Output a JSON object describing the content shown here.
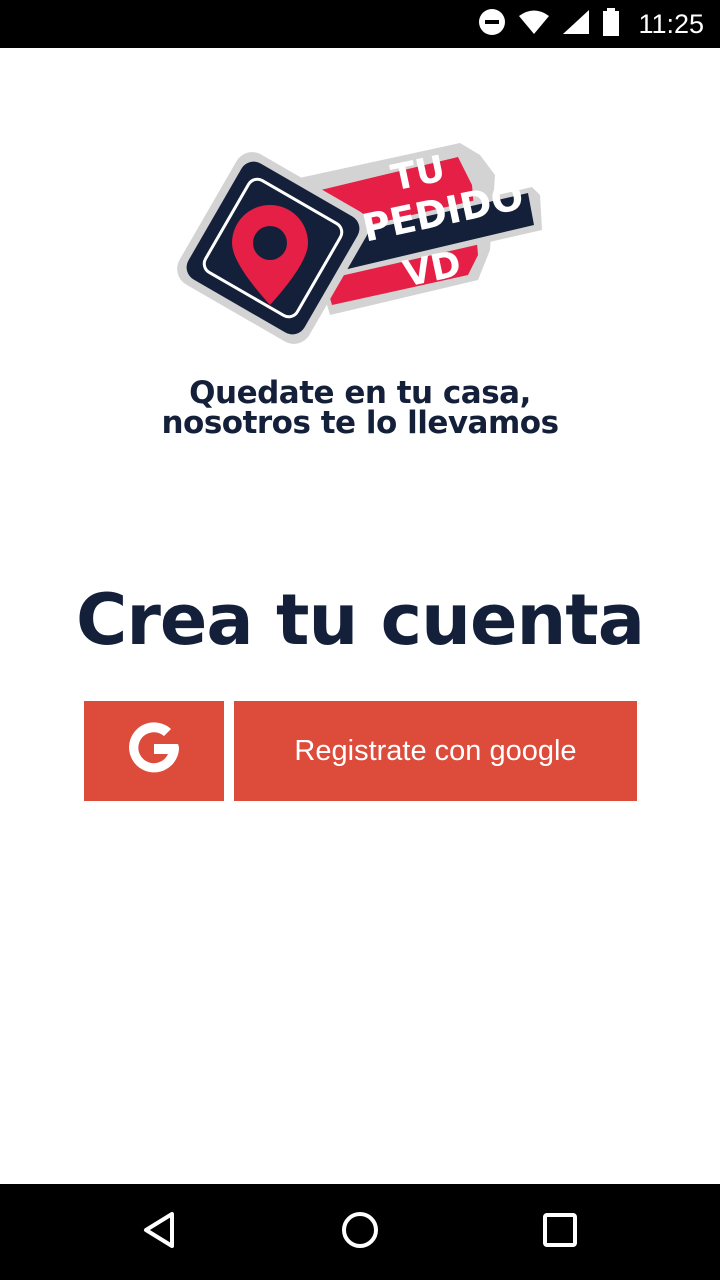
{
  "status_bar": {
    "time": "11:25",
    "icons": [
      "do-not-disturb-icon",
      "wifi-icon",
      "signal-icon",
      "battery-icon"
    ]
  },
  "logo": {
    "line1": "TU",
    "line2": "PEDIDO",
    "line3": "VD",
    "colors": {
      "navy": "#14203a",
      "red": "#e51f45",
      "gray": "#d3d3d3"
    }
  },
  "tagline": {
    "line1": "Quedate en tu casa,",
    "line2": "nosotros te lo llevamos"
  },
  "headline": "Crea tu cuenta",
  "google_button": {
    "label": "Registrate con google",
    "icon": "google-g-icon",
    "color": "#dd4b3b"
  },
  "nav_bar": {
    "icons": [
      "back-icon",
      "home-icon",
      "recent-apps-icon"
    ]
  }
}
